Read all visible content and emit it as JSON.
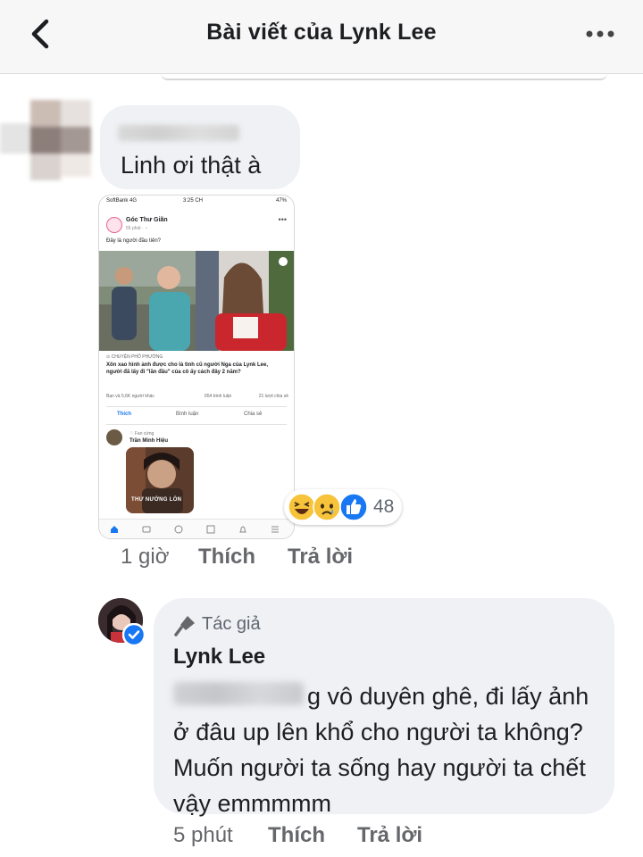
{
  "header": {
    "title": "Bài viết của Lynk Lee",
    "back_icon": "back-chevron-icon",
    "more_icon": "more-dots-icon",
    "background": "#f7f7f7"
  },
  "comment": {
    "text": "Linh ơi thật à",
    "time": "1 giờ",
    "like_label": "Thích",
    "reply_label": "Trả lời",
    "bubble_color": "#eff1f4",
    "reactions": {
      "icons": [
        "laugh-reaction-icon",
        "sad-reaction-icon",
        "like-reaction-icon"
      ],
      "count": "48"
    },
    "attachment": {
      "status_carrier": "SoftBank 4G",
      "status_time": "3:25 CH",
      "status_battery": "47%",
      "page_name": "Góc Thư Giãn",
      "page_time": "55 phút · ◔",
      "caption": "Đây là người đầu tiên?",
      "source": "⊙ CHUYỆN PHỐ PHƯỜNG",
      "headline": "Xôn xao hình ảnh được cho là tình cũ người Nga của Lynk Lee, người đã lấy đi \"lần đầu\" của cô ấy cách đây 2 năm?",
      "reactions_text": "Bạn và 5,6K người khác",
      "comments_text": "654 bình luận",
      "shares_text": "21 lượt chia sẻ",
      "like_action": "Thích",
      "comment_action": "Bình luận",
      "share_action": "Chia sẻ",
      "commenter_badge": "♡ Fan cứng",
      "commenter_name": "Trần Minh Hiệu",
      "meme_text": "THƯ NƯỚNG LÒN"
    }
  },
  "reply": {
    "author_badge": "Tác giả",
    "author_badge_icon": "microphone-icon",
    "name": "Lynk Lee",
    "text": "g vô duyên ghê, đi lấy ảnh ở đâu up lên khổ cho người ta không? Muốn người ta sống hay người ta chết vậy emmmmm",
    "time": "5 phút",
    "like_label": "Thích",
    "reply_label": "Trả lời",
    "verified_icon": "verified-badge-icon",
    "verified_color": "#1877f2"
  }
}
